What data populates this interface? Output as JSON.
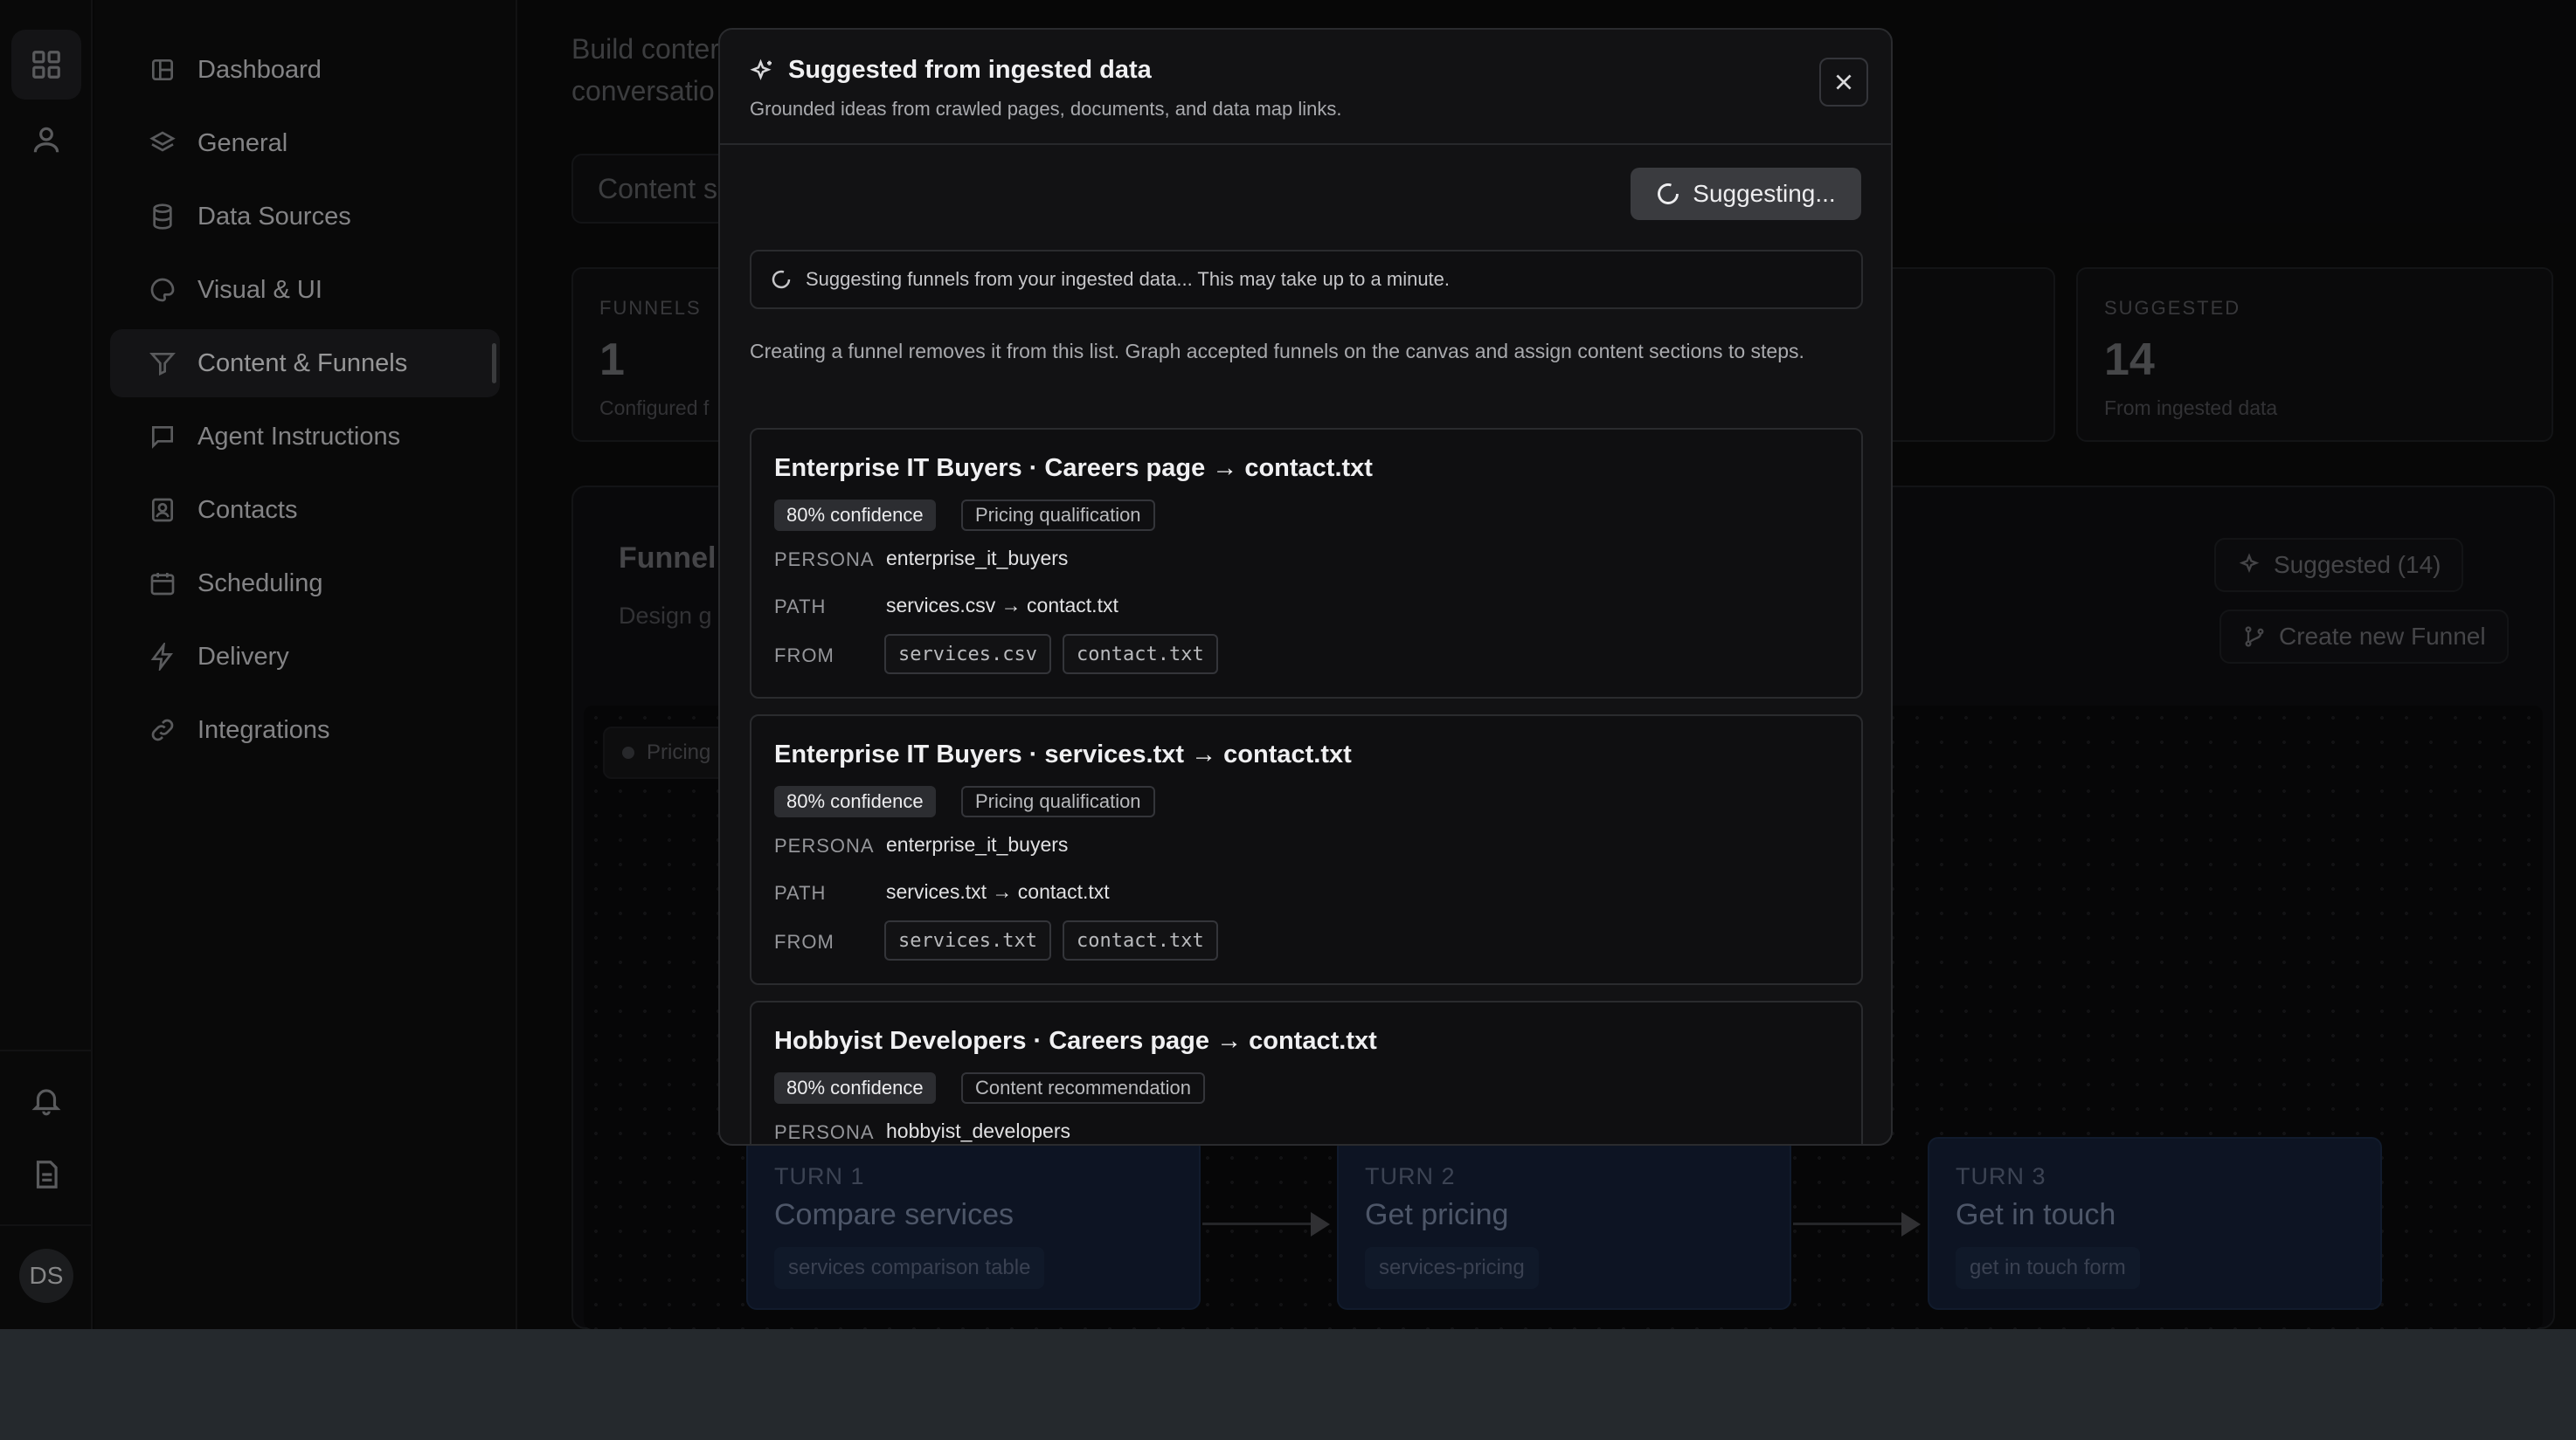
{
  "sidebar": {
    "items": [
      {
        "label": "Dashboard",
        "icon": "dashboard-icon"
      },
      {
        "label": "General",
        "icon": "layers-icon"
      },
      {
        "label": "Data Sources",
        "icon": "database-icon"
      },
      {
        "label": "Visual & UI",
        "icon": "palette-icon"
      },
      {
        "label": "Content & Funnels",
        "icon": "filter-icon",
        "active": true
      },
      {
        "label": "Agent Instructions",
        "icon": "message-icon"
      },
      {
        "label": "Contacts",
        "icon": "contact-icon"
      },
      {
        "label": "Scheduling",
        "icon": "calendar-icon"
      },
      {
        "label": "Delivery",
        "icon": "bolt-icon"
      },
      {
        "label": "Integrations",
        "icon": "link-icon"
      }
    ]
  },
  "rail": {
    "avatar_initials": "DS"
  },
  "background": {
    "subtitle_line1": "Build conter",
    "subtitle_line2": "conversatio",
    "content_search": "Content s",
    "stats": [
      {
        "label": "FUNNELS",
        "value": "1",
        "sub": "Configured f"
      },
      {
        "label": "SUGGESTED",
        "value": "14",
        "sub": "From ingested data"
      }
    ],
    "panel_title": "Funnel",
    "panel_sub": "Design g",
    "suggested_button": "Suggested (14)",
    "create_button": "Create new Funnel",
    "tag": "Pricing",
    "turns": [
      {
        "label": "TURN 1",
        "title": "Compare services",
        "chip": "services comparison table"
      },
      {
        "label": "TURN 2",
        "title": "Get pricing",
        "chip": "services-pricing"
      },
      {
        "label": "TURN 3",
        "title": "Get in touch",
        "chip": "get in touch form"
      }
    ]
  },
  "modal": {
    "title": "Suggested from ingested data",
    "subtitle": "Grounded ideas from crawled pages, documents, and data map links.",
    "suggest_button": "Suggesting...",
    "status": "Suggesting funnels from your ingested data... This may take up to a minute.",
    "note": "Creating a funnel removes it from this list. Graph accepted funnels on the canvas and assign content sections to steps.",
    "labels": {
      "persona": "PERSONA",
      "path": "PATH",
      "from": "FROM"
    },
    "cards": [
      {
        "title": "Enterprise IT Buyers · Careers page → contact.txt",
        "confidence": "80% confidence",
        "category": "Pricing qualification",
        "persona": "enterprise_it_buyers",
        "path": "services.csv → contact.txt",
        "from": [
          "services.csv",
          "contact.txt"
        ]
      },
      {
        "title": "Enterprise IT Buyers · services.txt → contact.txt",
        "confidence": "80% confidence",
        "category": "Pricing qualification",
        "persona": "enterprise_it_buyers",
        "path": "services.txt → contact.txt",
        "from": [
          "services.txt",
          "contact.txt"
        ]
      },
      {
        "title": "Hobbyist Developers · Careers page → contact.txt",
        "confidence": "80% confidence",
        "category": "Content recommendation",
        "persona": "hobbyist_developers"
      }
    ]
  }
}
